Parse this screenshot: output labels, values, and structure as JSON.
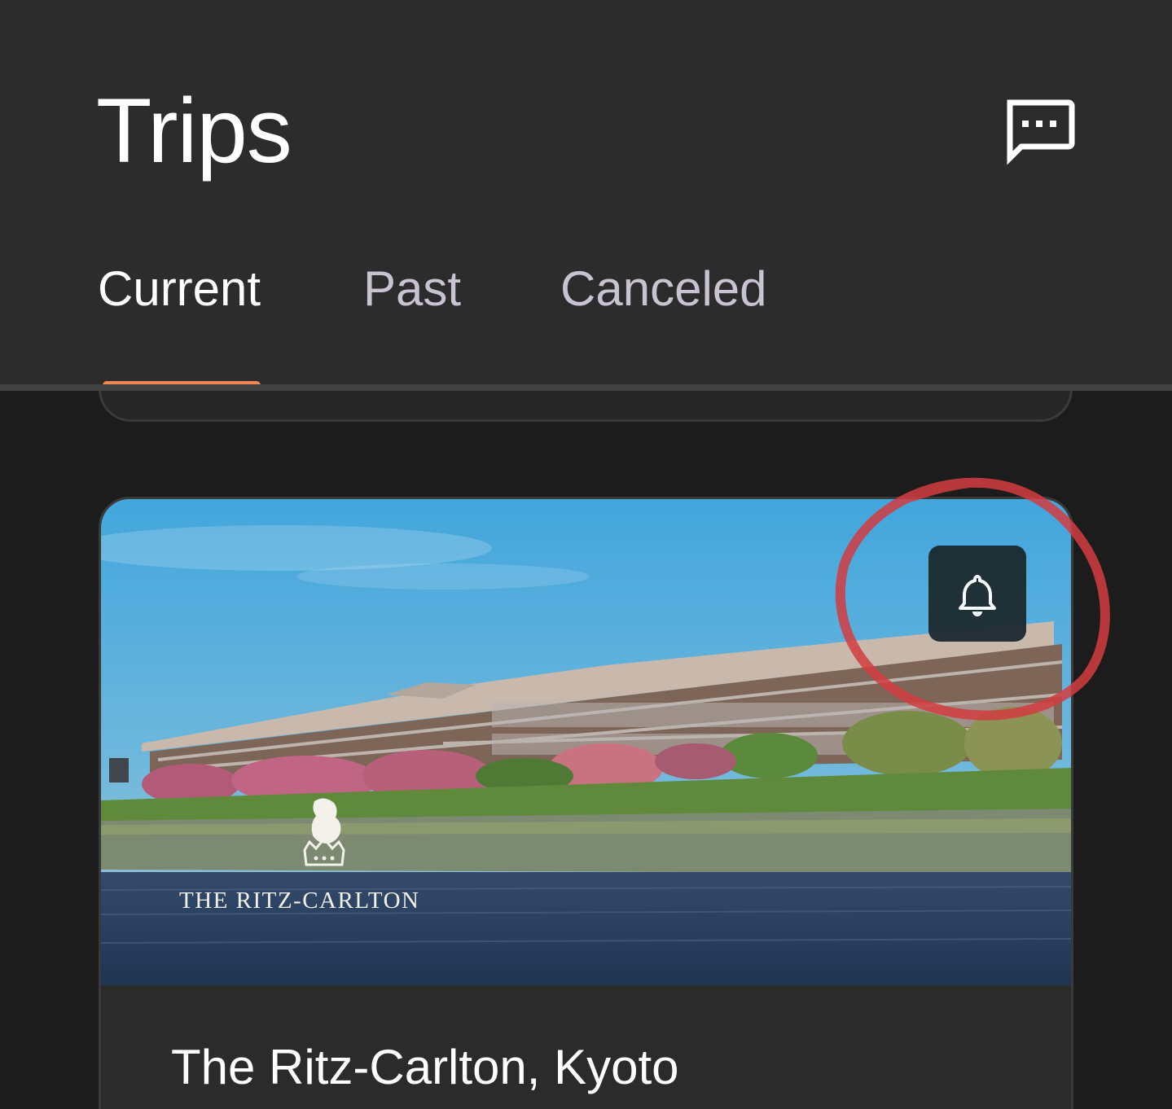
{
  "header": {
    "title": "Trips",
    "chat_icon": "chat-bubble-icon"
  },
  "tabs": [
    {
      "label": "Current",
      "selected": true
    },
    {
      "label": "Past",
      "selected": false
    },
    {
      "label": "Canceled",
      "selected": false
    }
  ],
  "colors": {
    "background": "#1c1c1c",
    "header": "#2c2c2c",
    "accent": "#f08650",
    "annotation": "#d23c41"
  },
  "trip_card": {
    "brand_logo_text": "THE RITZ-CARLTON",
    "hotel_name": "The Ritz-Carlton, Kyoto",
    "notify_icon": "bell-icon"
  }
}
